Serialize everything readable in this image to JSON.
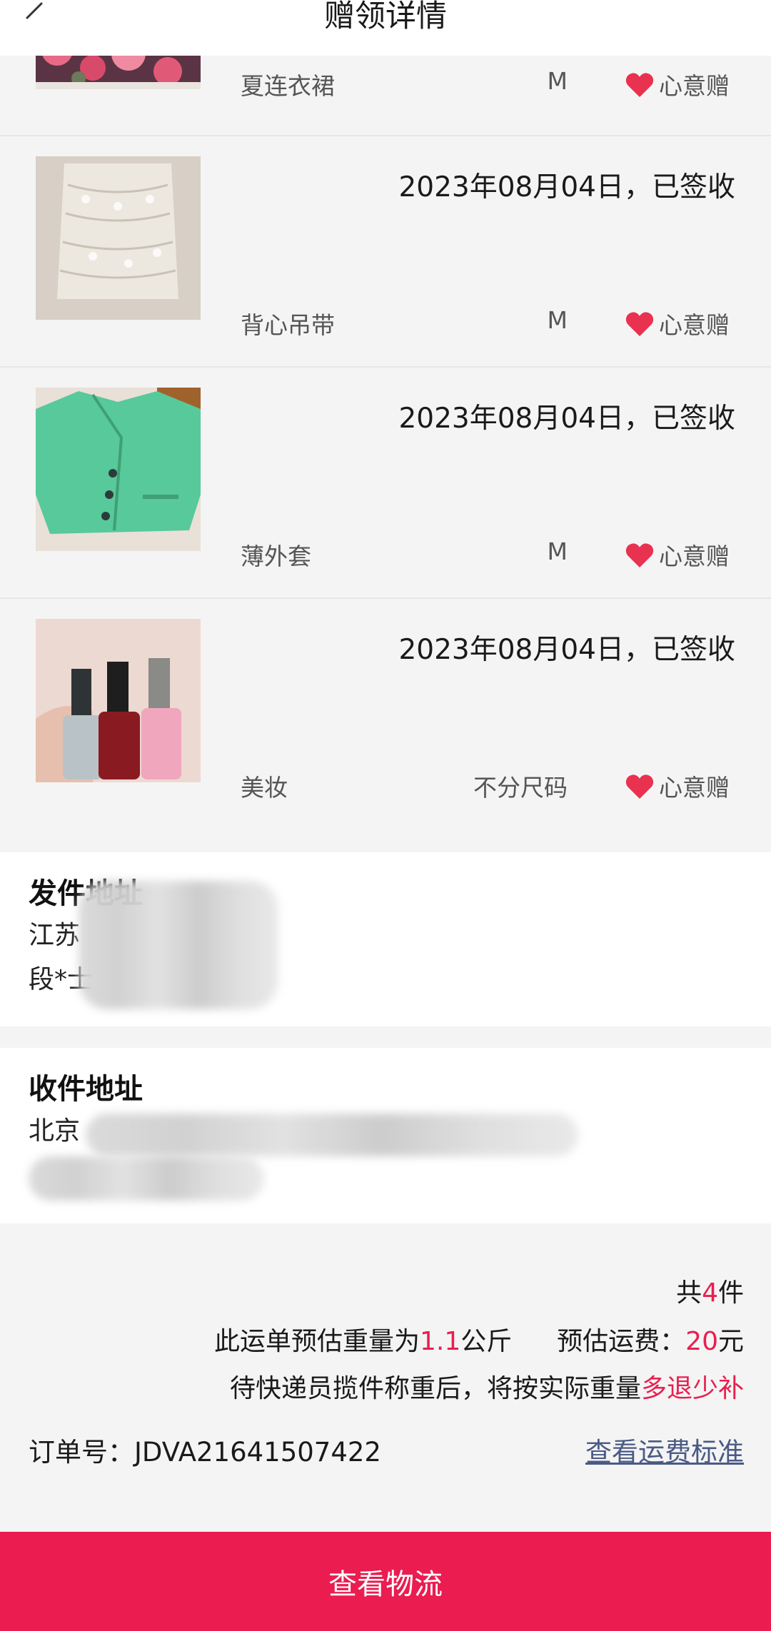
{
  "header": {
    "title": "赠领详情"
  },
  "items": [
    {
      "date": "",
      "name": "夏连衣裙",
      "size": "M",
      "tag": "心意赠"
    },
    {
      "date": "2023年08月04日，已签收",
      "name": "背心吊带",
      "size": "M",
      "tag": "心意赠"
    },
    {
      "date": "2023年08月04日，已签收",
      "name": "薄外套",
      "size": "M",
      "tag": "心意赠"
    },
    {
      "date": "2023年08月04日，已签收",
      "name": "美妆",
      "size": "不分尺码",
      "tag": "心意赠"
    }
  ],
  "sender": {
    "title": "发件地址",
    "line1": "江苏",
    "line2": "段*士"
  },
  "receiver": {
    "title": "收件地址",
    "line1": "北京",
    "line2": ""
  },
  "summary": {
    "count_prefix": "共",
    "count": "4",
    "count_suffix": "件",
    "weight_prefix": "此运单预估重量为",
    "weight": "1.1",
    "weight_unit": "公斤",
    "fee_prefix": "预估运费：",
    "fee": "20",
    "fee_unit": "元",
    "note_prefix": "待快递员揽件称重后，将按实际重量",
    "note_highlight": "多退少补",
    "order_label": "订单号：",
    "order_no": "JDVA21641507422",
    "fee_link": "查看运费标准"
  },
  "button": {
    "label": "查看物流"
  },
  "colors": {
    "accent": "#ea1c50",
    "heart": "#e8324f",
    "link": "#4a5a85"
  }
}
